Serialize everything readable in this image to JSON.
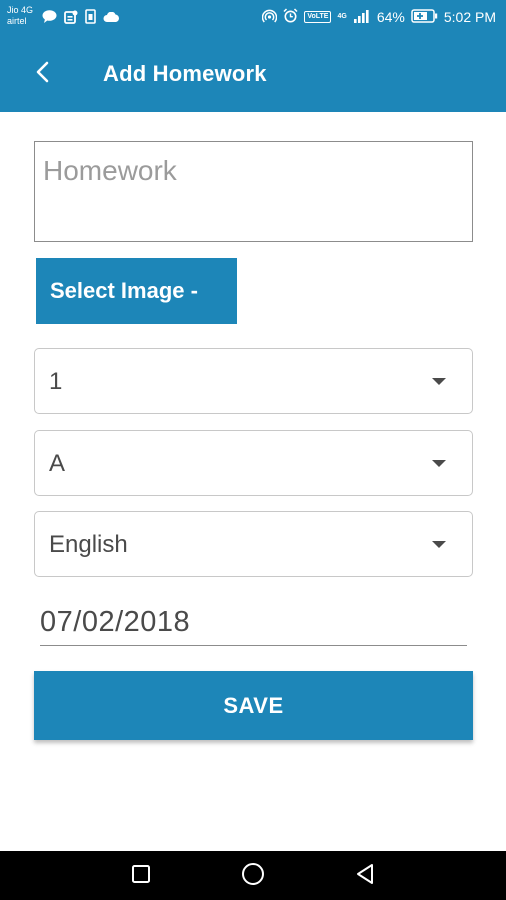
{
  "colors": {
    "brand": "#1d86b8",
    "text": "#4a4a4a",
    "placeholder": "#9b9b9b",
    "navbar": "#000000"
  },
  "status_bar": {
    "carrier_line1": "Jio 4G",
    "carrier_line2": "airtel",
    "volte_label": "VoLTE",
    "network_label": "4G",
    "battery_percent": "64%",
    "time": "5:02 PM",
    "left_icons": [
      "message-icon",
      "app-notification-icon",
      "sim-icon",
      "cloud-icon"
    ],
    "right_icons": [
      "hotspot-icon",
      "alarm-icon",
      "signal-icon",
      "battery-icon"
    ]
  },
  "app_bar": {
    "title": "Add Homework",
    "back_icon": "chevron-left-icon"
  },
  "form": {
    "homework_placeholder": "Homework",
    "homework_value": "",
    "select_image_label": "Select Image -",
    "class_value": "1",
    "section_value": "A",
    "subject_value": "English",
    "date_value": "07/02/2018",
    "save_label": "SAVE"
  },
  "nav_bar": {
    "icons": [
      "recents-square-icon",
      "home-circle-icon",
      "back-triangle-icon"
    ]
  }
}
